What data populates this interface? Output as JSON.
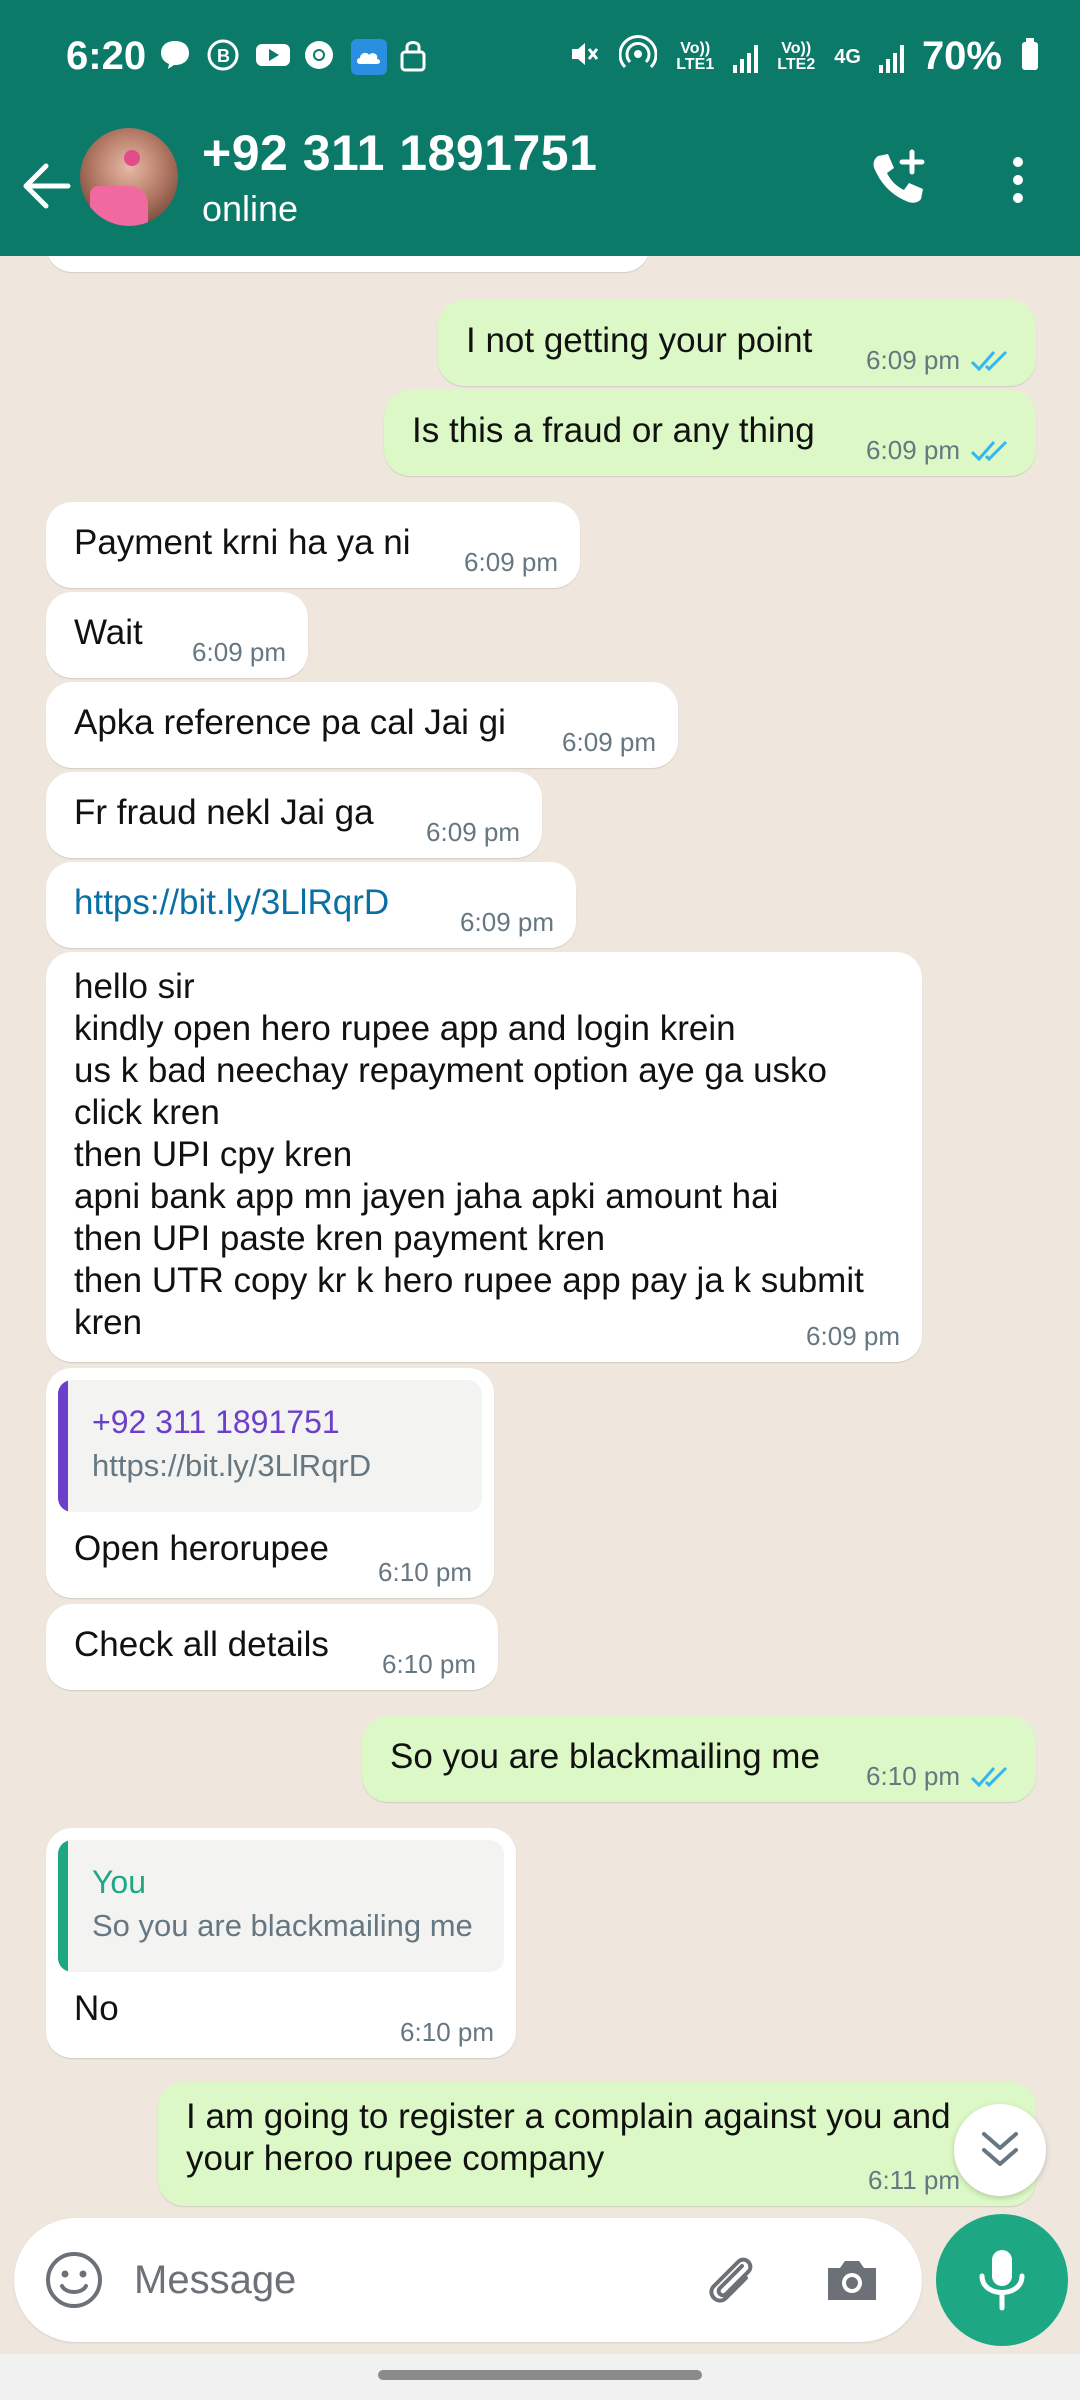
{
  "status_bar": {
    "time": "6:20",
    "battery": "70%",
    "sim1": "Vo)) LTE1",
    "sim2": "Vo)) LTE2",
    "network": "4G",
    "icons_left": [
      "chat-bubble-icon",
      "business-icon",
      "youtube-icon",
      "chrome-icon",
      "cloud-icon",
      "lock-icon"
    ],
    "icons_right": [
      "mute-icon",
      "hotspot-icon",
      "signal-icon",
      "signal-icon",
      "battery-icon"
    ]
  },
  "header": {
    "contact_name": "+92 311 1891751",
    "contact_status": "online",
    "icons": [
      "back-arrow-icon",
      "add-call-icon",
      "more-menu-icon"
    ]
  },
  "messages": [
    {
      "dir": "out",
      "text": "I not getting your point",
      "time": "6:09 pm",
      "read": true
    },
    {
      "dir": "out",
      "text": "Is this a fraud or any thing",
      "time": "6:09 pm",
      "read": true
    },
    {
      "dir": "in",
      "text": "Payment krni ha ya ni",
      "time": "6:09 pm"
    },
    {
      "dir": "in",
      "text": "Wait",
      "time": "6:09 pm"
    },
    {
      "dir": "in",
      "text": "Apka reference pa cal Jai gi",
      "time": "6:09 pm"
    },
    {
      "dir": "in",
      "text": "Fr fraud nekl Jai ga",
      "time": "6:09 pm"
    },
    {
      "dir": "in",
      "text": "https://bit.ly/3LlRqrD",
      "time": "6:09 pm",
      "is_link": true
    },
    {
      "dir": "in",
      "text": "hello sir\nkindly open hero rupee app and login krein\nus k bad neechay repayment option aye ga usko\nclick kren\nthen UPI cpy kren\napni bank app mn jayen jaha apki amount hai\nthen UPI paste kren payment kren\nthen UTR copy kr k hero rupee app pay ja k submit\nkren",
      "time": "6:09 pm"
    },
    {
      "dir": "in",
      "quote_name": "+92 311 1891751",
      "quote_text": "https://bit.ly/3LlRqrD",
      "text": "Open herorupee",
      "time": "6:10 pm"
    },
    {
      "dir": "in",
      "text": "Check all details",
      "time": "6:10 pm"
    },
    {
      "dir": "out",
      "text": "So you are blackmailing me",
      "time": "6:10 pm",
      "read": true
    },
    {
      "dir": "in",
      "quote_name": "You",
      "quote_text": "So you are blackmailing me",
      "text": "No",
      "time": "6:10 pm"
    },
    {
      "dir": "out",
      "text": "I am going to register a complain against you and\nyour heroo rupee company",
      "time": "6:11 pm",
      "read": true
    }
  ],
  "input": {
    "placeholder": "Message",
    "icons": [
      "emoji-icon",
      "attach-icon",
      "camera-icon",
      "mic-icon"
    ]
  },
  "colors": {
    "header_bg": "#0b7a68",
    "chat_bg": "#efe7de",
    "bubble_out": "#dcf8c6",
    "bubble_in": "#ffffff",
    "tick_read": "#34b7f1",
    "link": "#0a6fa3",
    "quote_bar_contact": "#6b3fc9",
    "quote_bar_self": "#1da883",
    "mic_button": "#1da883"
  }
}
